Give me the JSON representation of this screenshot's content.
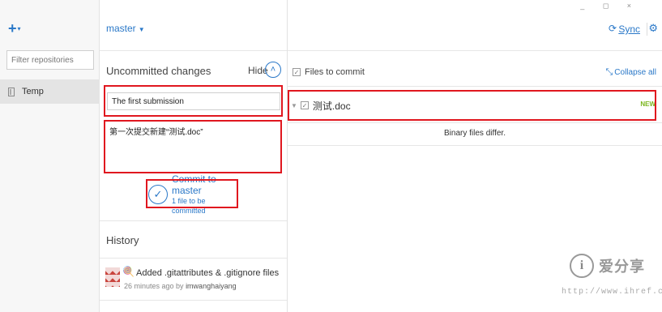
{
  "toolbar": {
    "add_icon": "plus-icon",
    "branch": "master",
    "sync_label": "Sync",
    "window_controls": "_ ◻ ×"
  },
  "sidebar": {
    "filter_placeholder": "Filter repositories",
    "repositories": [
      {
        "label": "Temp",
        "icon": "repo-icon"
      }
    ]
  },
  "changes": {
    "title": "Uncommitted changes",
    "hide_label": "Hide",
    "summary_value": "The first submission",
    "description_value": "第一次提交新建“测试.doc”",
    "commit_label": "Commit to master",
    "commit_sub": "1 file to be committed"
  },
  "history": {
    "title": "History",
    "items": [
      {
        "message": "Added .gitattributes & .gitignore files",
        "time": "26 minutes ago by",
        "author": "imwanghaiyang"
      }
    ]
  },
  "files": {
    "header_label": "Files to commit",
    "collapse_label": "Collapse all",
    "items": [
      {
        "name": "测试.doc",
        "status": "NEW",
        "checked": true
      }
    ],
    "diff_message": "Binary files differ."
  },
  "watermark": {
    "title": "爱分享",
    "url": "http://www.ihref.com"
  },
  "colors": {
    "accent": "#2a78c8",
    "highlight": "#e0171f",
    "new_badge": "#7ab51d"
  }
}
